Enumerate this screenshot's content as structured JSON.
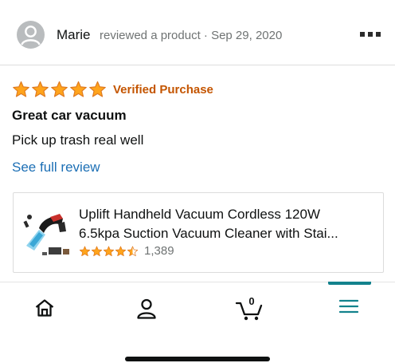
{
  "review": {
    "author": "Marie",
    "meta": "reviewed a product · Sep 29, 2020",
    "rating": 5,
    "badge": "Verified Purchase",
    "title": "Great car vacuum",
    "text": "Pick up trash real well",
    "link": "See full review"
  },
  "product": {
    "name_line1": "Uplift Handheld Vacuum Cordless 120W",
    "name_line2": "6.5kpa Suction Vacuum Cleaner with Stai...",
    "rating": 4.5,
    "rating_count": "1,389"
  },
  "tabbar": {
    "tabs": [
      {
        "name": "home",
        "icon": "home-icon"
      },
      {
        "name": "account",
        "icon": "person-icon"
      },
      {
        "name": "cart",
        "icon": "cart-icon",
        "count": "0"
      },
      {
        "name": "menu",
        "icon": "hamburger-menu-icon",
        "active": true
      }
    ]
  },
  "colors": {
    "star": "#ffa41c",
    "badge": "#c45500",
    "link": "#1c6fb5",
    "active_tab": "#13828d",
    "muted": "#6f7373"
  }
}
